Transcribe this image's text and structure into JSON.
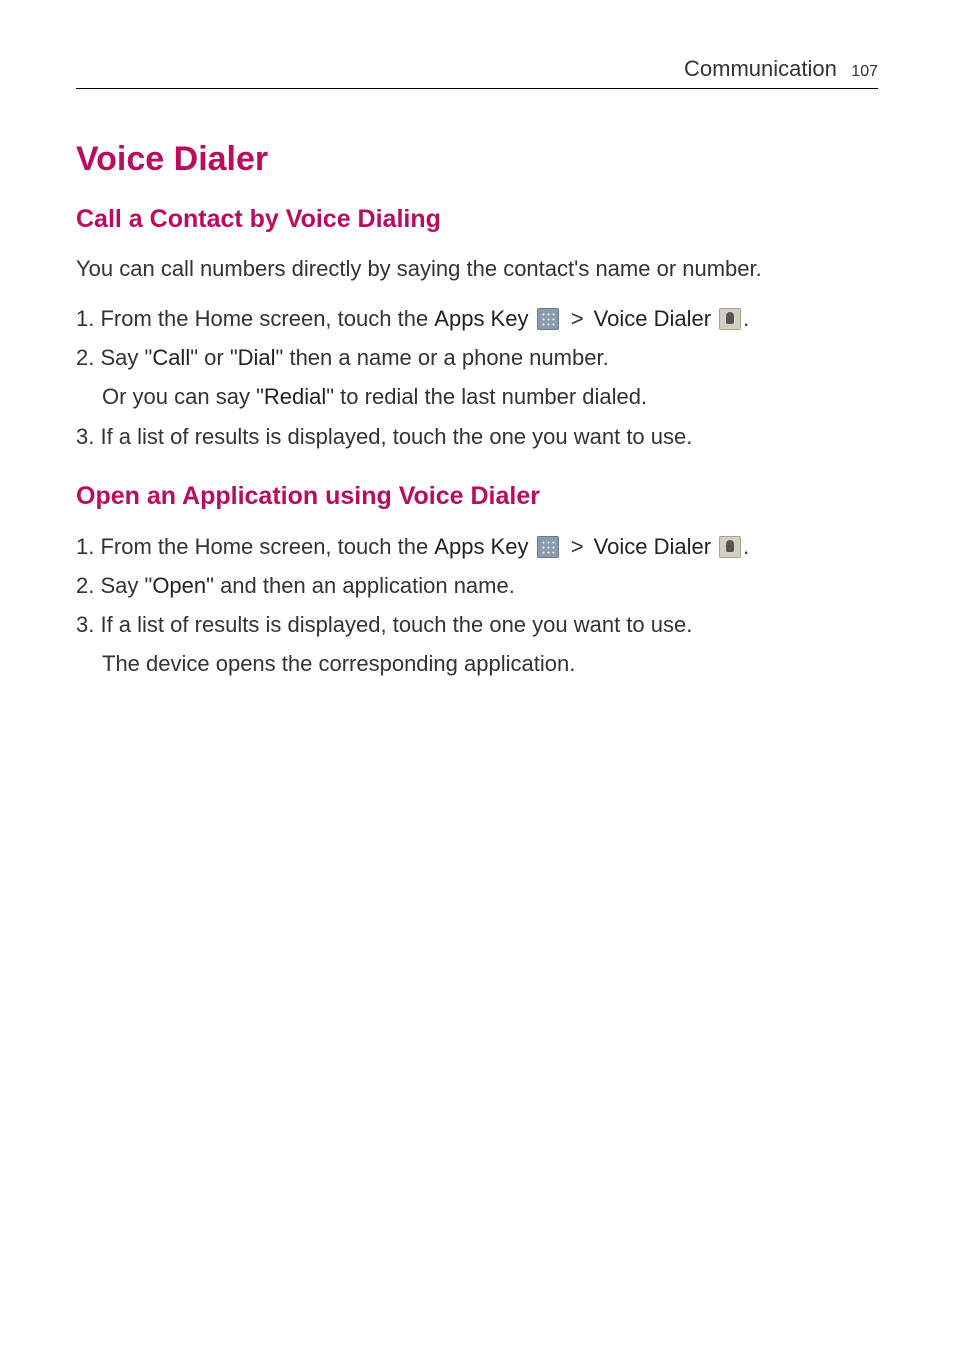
{
  "header": {
    "title": "Communication",
    "page": "107"
  },
  "mainHeading": "Voice Dialer",
  "section1": {
    "heading": "Call a Contact by Voice Dialing",
    "intro": "You can call numbers directly by saying the contact's name or number.",
    "items": [
      {
        "num": "1.",
        "pre": " From the Home screen, touch the ",
        "bold1": "Apps Key ",
        "sep": " > ",
        "bold2": "Voice Dialer ",
        "post": "."
      },
      {
        "num": "2.",
        "pre": " Say \"",
        "bold1": "Call",
        "mid1": "\" or \"",
        "bold2": "Dial",
        "mid2": "\" then a name or a phone number.",
        "cont_pre": "Or you can say \"",
        "cont_bold": "Redial",
        "cont_post": "\" to redial the last number dialed."
      },
      {
        "num": "3.",
        "text": " If a list of results is displayed, touch the one you want to use."
      }
    ]
  },
  "section2": {
    "heading": "Open an Application using Voice Dialer",
    "items": [
      {
        "num": "1.",
        "pre": " From the Home screen, touch the ",
        "bold1": "Apps Key ",
        "sep": " > ",
        "bold2": "Voice Dialer ",
        "post": "."
      },
      {
        "num": "2.",
        "pre": " Say \"",
        "bold1": "Open",
        "post": "\" and then an application name."
      },
      {
        "num": "3.",
        "text": " If a list of results is displayed, touch the one you want to use.",
        "cont": "The device opens the corresponding application."
      }
    ]
  }
}
